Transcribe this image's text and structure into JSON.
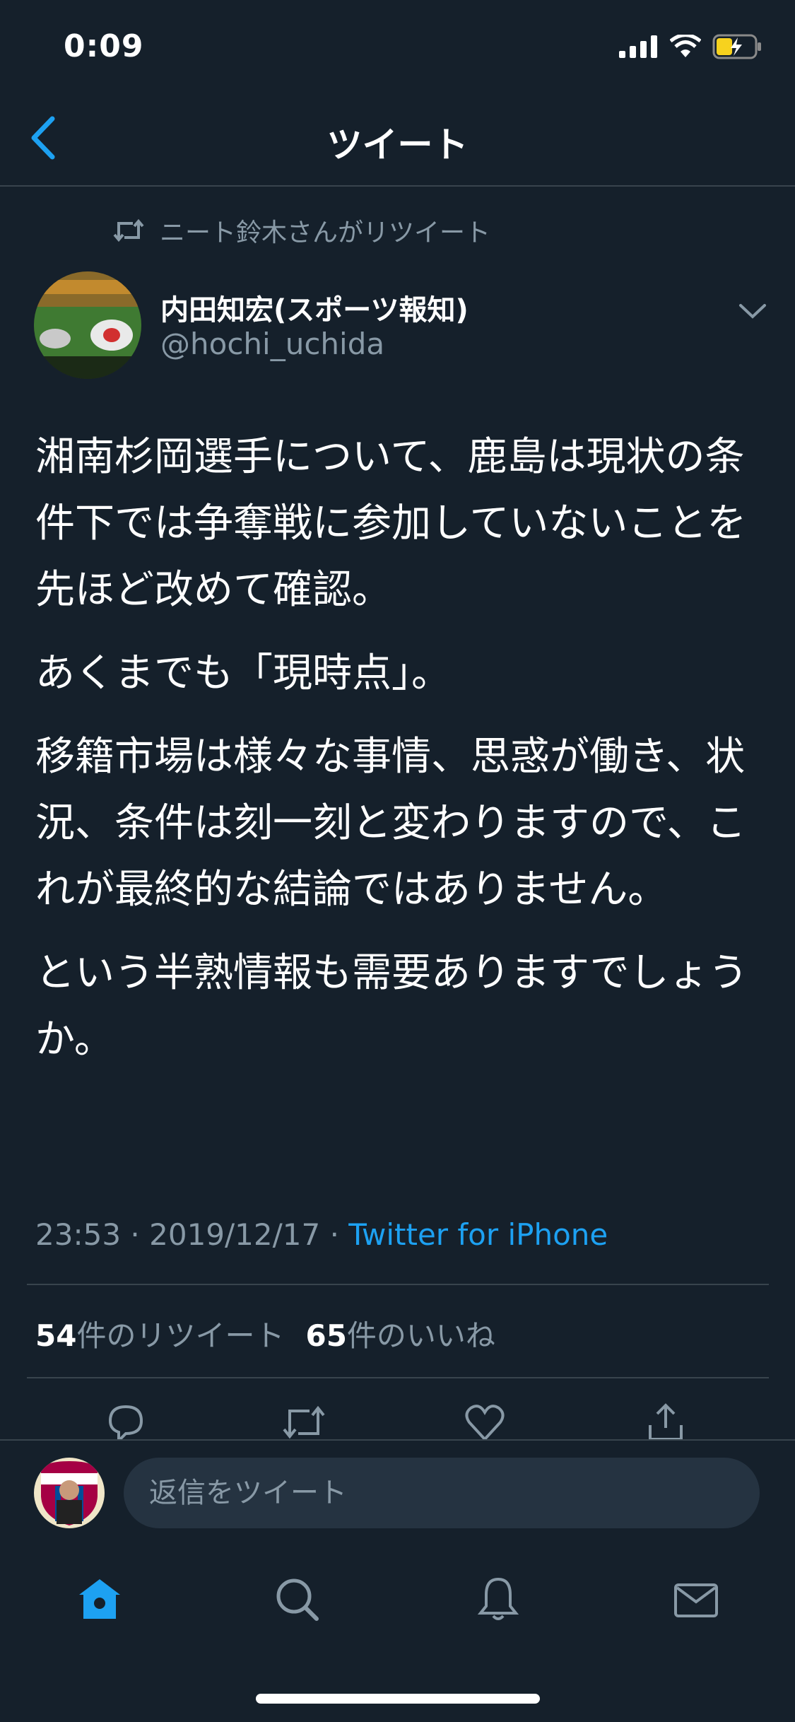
{
  "status": {
    "time": "0:09"
  },
  "nav": {
    "title": "ツイート"
  },
  "retweet_context": {
    "text": "ニート鈴木さんがリツイート"
  },
  "author": {
    "name": "内田知宏(スポーツ報知)",
    "handle": "@hochi_uchida"
  },
  "tweet": {
    "paragraphs": [
      "湘南杉岡選手について、鹿島は現状の条件下では争奪戦に参加していないことを先ほど改めて確認。",
      "あくまでも「現時点」。",
      "移籍市場は様々な事情、思惑が働き、状況、条件は刻一刻と変わりますので、これが最終的な結論ではありません。",
      "という半熟情報も需要ありますでしょうか。"
    ],
    "time": "23:53",
    "date": "2019/12/17",
    "separator": "·",
    "source": "Twitter for iPhone"
  },
  "stats": {
    "retweets_count": "54",
    "retweets_label": "件のリツイート",
    "likes_count": "65",
    "likes_label": "件のいいね"
  },
  "reply": {
    "placeholder": "返信をツイート"
  },
  "colors": {
    "background": "#15202b",
    "accent": "#1da1f2",
    "muted": "#8899a6",
    "divider": "#38444d"
  },
  "icons": [
    "chevron-left-icon",
    "retweet-icon",
    "chevron-down-icon",
    "reply-icon",
    "like-icon",
    "share-icon",
    "home-icon",
    "search-icon",
    "bell-icon",
    "mail-icon"
  ]
}
